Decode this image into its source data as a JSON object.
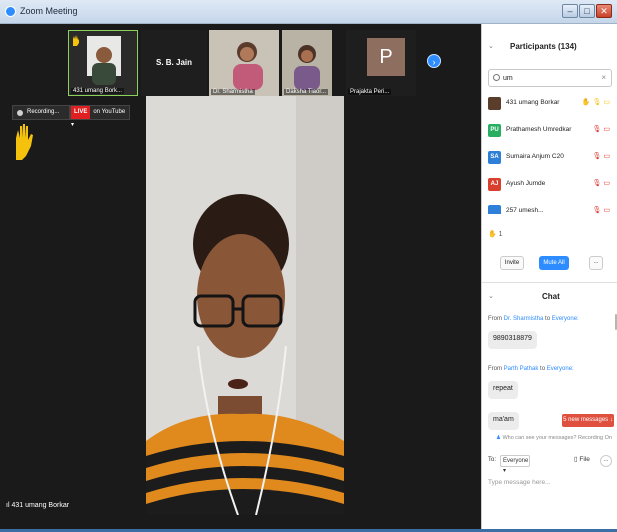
{
  "window": {
    "title": "Zoom Meeting",
    "min_label": "–",
    "max_label": "□",
    "close_label": "✕"
  },
  "thumbnails": [
    {
      "name": "431 umang Bork...",
      "has_hand": true
    },
    {
      "name": "S. B. Jain"
    },
    {
      "name": "Dr. Sharmistha"
    },
    {
      "name": "Daksha Tiaor..."
    },
    {
      "name": "Prajakta Peri...",
      "avatar_letter": "P"
    }
  ],
  "toolbar": {
    "recording_label": "Recording...",
    "live_badge": "LIVE",
    "live_label": "on YouTube ▾"
  },
  "main_video": {
    "speaker_name": "431 umang Borkar"
  },
  "participants": {
    "title": "Participants (134)",
    "search_value": "um",
    "search_clear": "×",
    "list": [
      {
        "name": "431 umang Borkar",
        "initials": "",
        "color": "#5a3e2b",
        "status": "✋ 🎙 ▭"
      },
      {
        "name": "Prathamesh Umredkar",
        "initials": "PU",
        "color": "#27ae60",
        "status": "🎙 ▭"
      },
      {
        "name": "Sumaira Anjum C20",
        "initials": "SA",
        "color": "#2d7fd8",
        "status": "🎙 ▭"
      },
      {
        "name": "Ayush Jumde",
        "initials": "AJ",
        "color": "#d8402d",
        "status": "🎙 ▭"
      },
      {
        "name": "257 umesh...",
        "initials": "",
        "color": "#2d7fd8",
        "status": "🎙 ▭"
      }
    ],
    "raised_hands": "1",
    "invite_label": "Invite",
    "mute_all_label": "Mute All",
    "more_label": "..."
  },
  "chat": {
    "title": "Chat",
    "messages": [
      {
        "from_prefix": "From ",
        "from": "Dr. Sharmistha",
        "to_prefix": " to ",
        "to": "Everyone:",
        "text": "9890318879"
      },
      {
        "from_prefix": "From ",
        "from": "Parth Pathak",
        "to_prefix": " to ",
        "to": "Everyone:",
        "text": "repeat"
      },
      {
        "text": "ma'am"
      }
    ],
    "new_messages": "5 new messages ↓",
    "who_can_see": "Who can see your messages? Recording On",
    "to_label": "To:",
    "to_value": "Everyone ▾",
    "file_label": "File",
    "file_more": "...",
    "input_placeholder": "Type message here..."
  },
  "colors": {
    "accent": "#2d8cff",
    "alert": "#e0503e",
    "live": "#e02020"
  }
}
